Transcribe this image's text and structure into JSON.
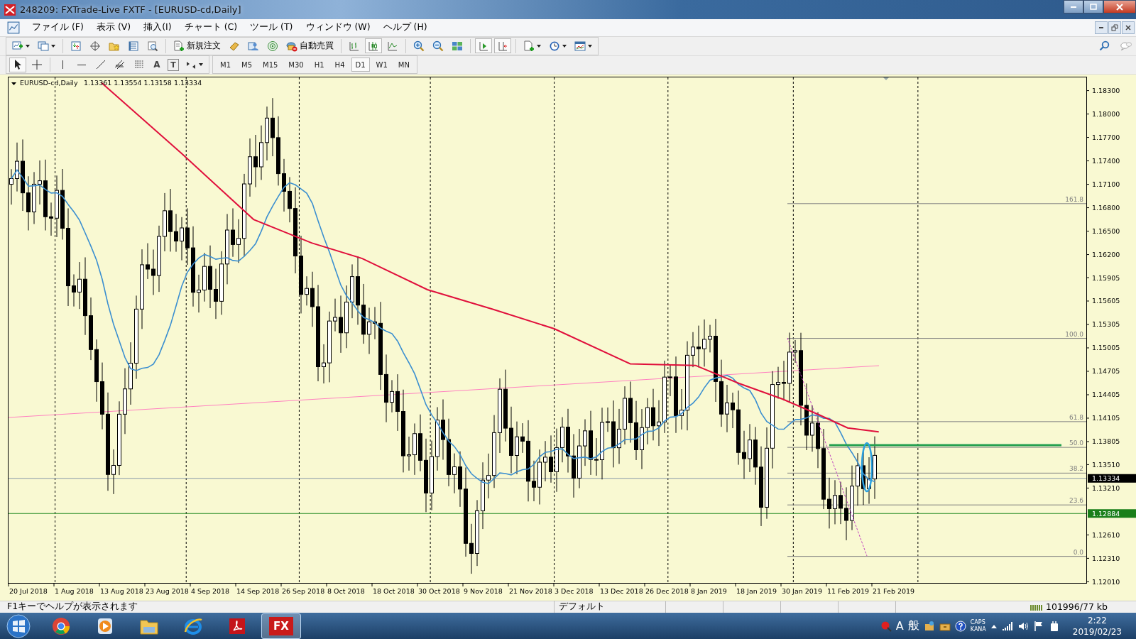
{
  "window": {
    "title": "248209: FXTrade-Live FXTF - [EURUSD-cd,Daily]"
  },
  "menu": [
    "ファイル (F)",
    "表示 (V)",
    "挿入(I)",
    "チャート (C)",
    "ツール (T)",
    "ウィンドウ (W)",
    "ヘルプ (H)"
  ],
  "toolbar": [
    {
      "kind": "new-chart",
      "pressed": false,
      "dropdown": true
    },
    {
      "kind": "profiles",
      "pressed": false,
      "dropdown": true
    },
    {
      "kind": "sep"
    },
    {
      "kind": "market",
      "pressed": false
    },
    {
      "kind": "crosshair",
      "pressed": false
    },
    {
      "kind": "folder",
      "pressed": false
    },
    {
      "kind": "list",
      "pressed": false
    },
    {
      "kind": "tester",
      "pressed": false
    },
    {
      "kind": "sep"
    },
    {
      "kind": "order",
      "pressed": false,
      "label": "新規注文"
    },
    {
      "kind": "editor",
      "pressed": false
    },
    {
      "kind": "person",
      "pressed": false
    },
    {
      "kind": "signal",
      "pressed": false
    },
    {
      "kind": "robot",
      "pressed": false,
      "label": "自動売買"
    },
    {
      "kind": "sep"
    },
    {
      "kind": "bars",
      "pressed": false
    },
    {
      "kind": "candles",
      "pressed": true
    },
    {
      "kind": "line",
      "pressed": false
    },
    {
      "kind": "sep"
    },
    {
      "kind": "zoom-in",
      "pressed": false
    },
    {
      "kind": "zoom-out",
      "pressed": false
    },
    {
      "kind": "tile",
      "pressed": false
    },
    {
      "kind": "sep"
    },
    {
      "kind": "autoscroll",
      "pressed": true
    },
    {
      "kind": "shift",
      "pressed": true
    },
    {
      "kind": "sep"
    },
    {
      "kind": "indicator",
      "pressed": false,
      "dropdown": true
    },
    {
      "kind": "clock",
      "pressed": false,
      "dropdown": true
    },
    {
      "kind": "template",
      "pressed": false,
      "dropdown": true
    }
  ],
  "drawing_tools": [
    {
      "kind": "cursor",
      "pressed": true
    },
    {
      "kind": "cross",
      "pressed": false
    },
    {
      "kind": "sep"
    },
    {
      "kind": "vline",
      "pressed": false
    },
    {
      "kind": "hline",
      "pressed": false
    },
    {
      "kind": "trend",
      "pressed": false
    },
    {
      "kind": "channel",
      "pressed": false
    },
    {
      "kind": "fibo",
      "pressed": false
    },
    {
      "kind": "text",
      "pressed": false,
      "label": "A"
    },
    {
      "kind": "label",
      "pressed": false,
      "label": "T"
    },
    {
      "kind": "arrows",
      "pressed": false,
      "dropdown": true
    }
  ],
  "timeframes": [
    {
      "label": "M1",
      "selected": false
    },
    {
      "label": "M5",
      "selected": false
    },
    {
      "label": "M15",
      "selected": false
    },
    {
      "label": "M30",
      "selected": false
    },
    {
      "label": "H1",
      "selected": false
    },
    {
      "label": "H4",
      "selected": false
    },
    {
      "label": "D1",
      "selected": true
    },
    {
      "label": "W1",
      "selected": false
    },
    {
      "label": "MN",
      "selected": false
    }
  ],
  "chart": {
    "symbol": "EURUSD-cd,Daily",
    "ohlc": "1.13361 1.13554 1.13158 1.13334",
    "price_scale": [
      "1.18300",
      "1.18000",
      "1.17700",
      "1.17400",
      "1.17100",
      "1.16800",
      "1.16500",
      "1.16200",
      "1.15905",
      "1.15605",
      "1.15305",
      "1.15005",
      "1.14705",
      "1.14405",
      "1.14105",
      "1.13805",
      "1.13510",
      "1.13210",
      "1.12610",
      "1.12310",
      "1.12010"
    ],
    "current_price": "1.13334",
    "line_price": "1.12884",
    "fibonacci_levels": [
      "161.8",
      "100.0",
      "61.8",
      "50.0",
      "38.2",
      "23.6",
      "0.0"
    ],
    "dates": [
      "20 Jul 2018",
      "1 Aug 2018",
      "13 Aug 2018",
      "23 Aug 2018",
      "4 Sep 2018",
      "14 Sep 2018",
      "26 Sep 2018",
      "8 Oct 2018",
      "18 Oct 2018",
      "30 Oct 2018",
      "9 Nov 2018",
      "21 Nov 2018",
      "3 Dec 2018",
      "13 Dec 2018",
      "26 Dec 2018",
      "8 Jan 2019",
      "18 Jan 2019",
      "30 Jan 2019",
      "11 Feb 2019",
      "21 Feb 2019"
    ]
  },
  "status_bar": {
    "help": "F1キーでヘルプが表示されます",
    "profile": "デフォルト",
    "traffic": "101996/77 kb"
  },
  "taskbar": {
    "apps": [
      {
        "kind": "browser",
        "active": false
      },
      {
        "kind": "player",
        "active": false
      },
      {
        "kind": "explorer",
        "active": false
      },
      {
        "kind": "ie",
        "active": false
      },
      {
        "kind": "pdf",
        "active": false
      },
      {
        "kind": "fx",
        "active": true,
        "label": "FX"
      }
    ],
    "tray": {
      "ime_mode": "A",
      "ime_kanji": "般",
      "caps": "CAPS",
      "kana": "KANA",
      "time": "2:22",
      "date": "2019/02/23"
    }
  }
}
